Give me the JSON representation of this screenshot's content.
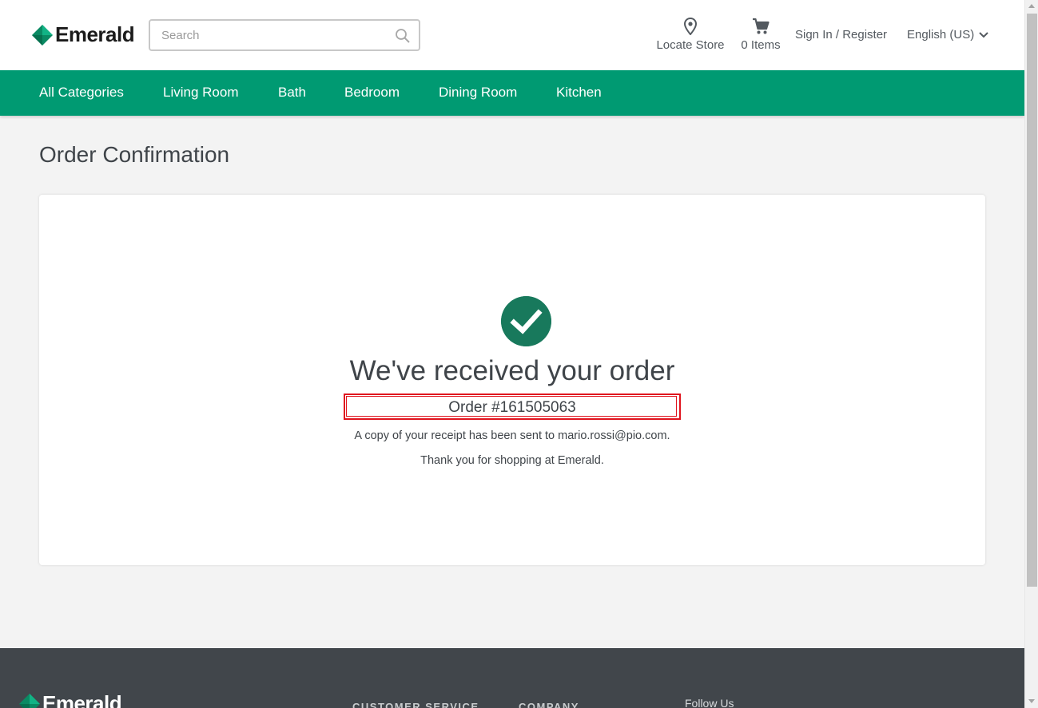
{
  "header": {
    "brand": "Emerald",
    "search_placeholder": "Search",
    "locate_label": "Locate Store",
    "cart_label": "0 Items",
    "signin_label": "Sign In / Register",
    "language_label": "English (US)"
  },
  "nav": {
    "items": [
      "All Categories",
      "Living Room",
      "Bath",
      "Bedroom",
      "Dining Room",
      "Kitchen"
    ]
  },
  "main": {
    "page_title": "Order Confirmation",
    "heading": "We've received your order",
    "order_number": "Order #161505063",
    "receipt_text": "A copy of your receipt has been sent to mario.rossi@pio.com.",
    "thanks_text": "Thank you for shopping at Emerald."
  },
  "footer": {
    "brand": "Emerald",
    "customer_service": "CUSTOMER SERVICE",
    "company": "COMPANY",
    "follow_us": "Follow Us"
  },
  "colors": {
    "brand_green": "#009a72",
    "check_green": "#18795c",
    "highlight_red": "#e0141e",
    "footer_bg": "#41464b"
  }
}
